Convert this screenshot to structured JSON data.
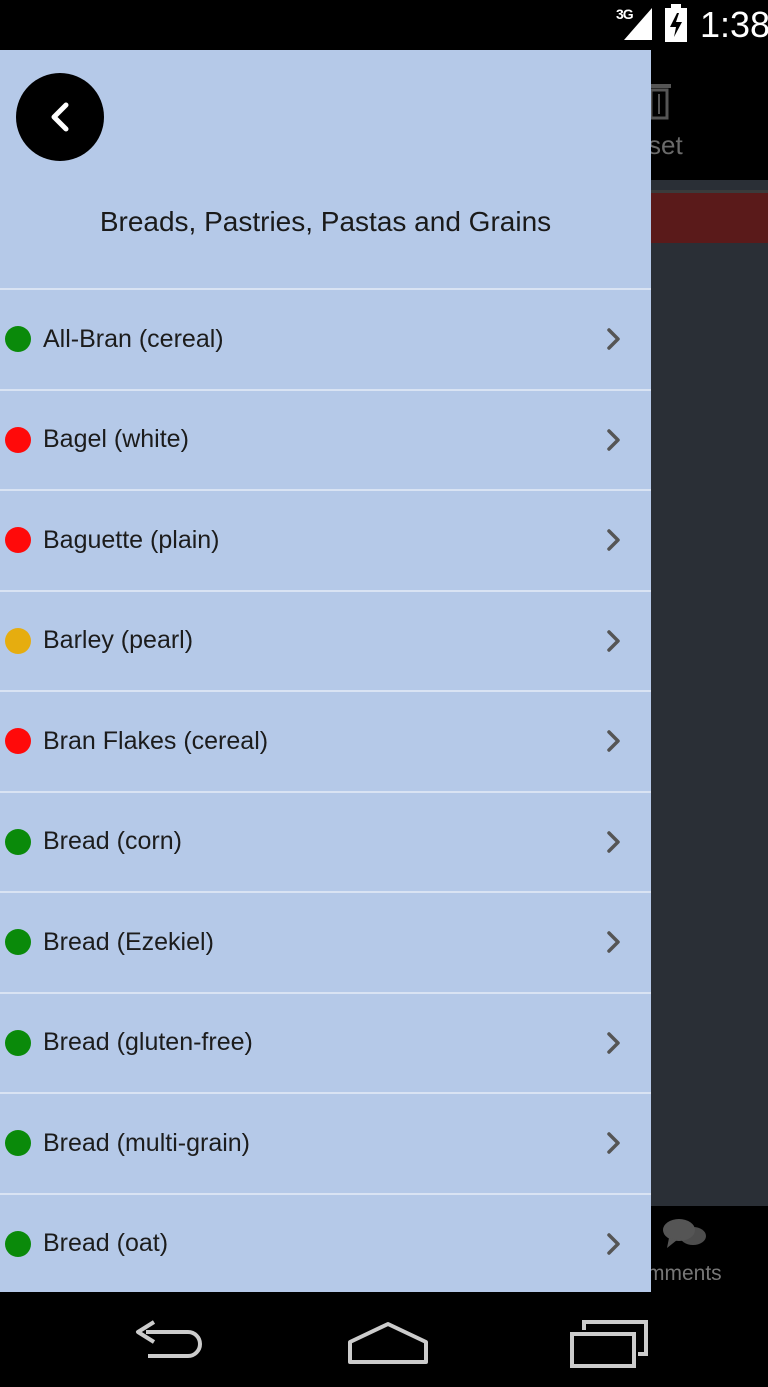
{
  "status_bar": {
    "network": "3G",
    "time": "1:38"
  },
  "background_app": {
    "reset_label": "set",
    "comments_label": "mments"
  },
  "drawer": {
    "title": "Breads, Pastries, Pastas and Grains",
    "items": [
      {
        "label": "All-Bran (cereal)",
        "status": "green"
      },
      {
        "label": "Bagel (white)",
        "status": "red"
      },
      {
        "label": "Baguette (plain)",
        "status": "red"
      },
      {
        "label": "Barley (pearl)",
        "status": "yellow"
      },
      {
        "label": "Bran Flakes (cereal)",
        "status": "red"
      },
      {
        "label": "Bread (corn)",
        "status": "green"
      },
      {
        "label": "Bread (Ezekiel)",
        "status": "green"
      },
      {
        "label": "Bread (gluten-free)",
        "status": "green"
      },
      {
        "label": "Bread (multi-grain)",
        "status": "green"
      },
      {
        "label": "Bread (oat)",
        "status": "green"
      }
    ]
  },
  "colors": {
    "green": "#0a8a0a",
    "red": "#ff0a0a",
    "yellow": "#e6ad0f",
    "drawer_bg": "#b5c9e8"
  },
  "icons": {
    "back": "chevron-left-icon",
    "row": "chevron-right-icon",
    "nav_back": "back-arrow-icon",
    "nav_home": "home-icon",
    "nav_recents": "recents-icon"
  }
}
